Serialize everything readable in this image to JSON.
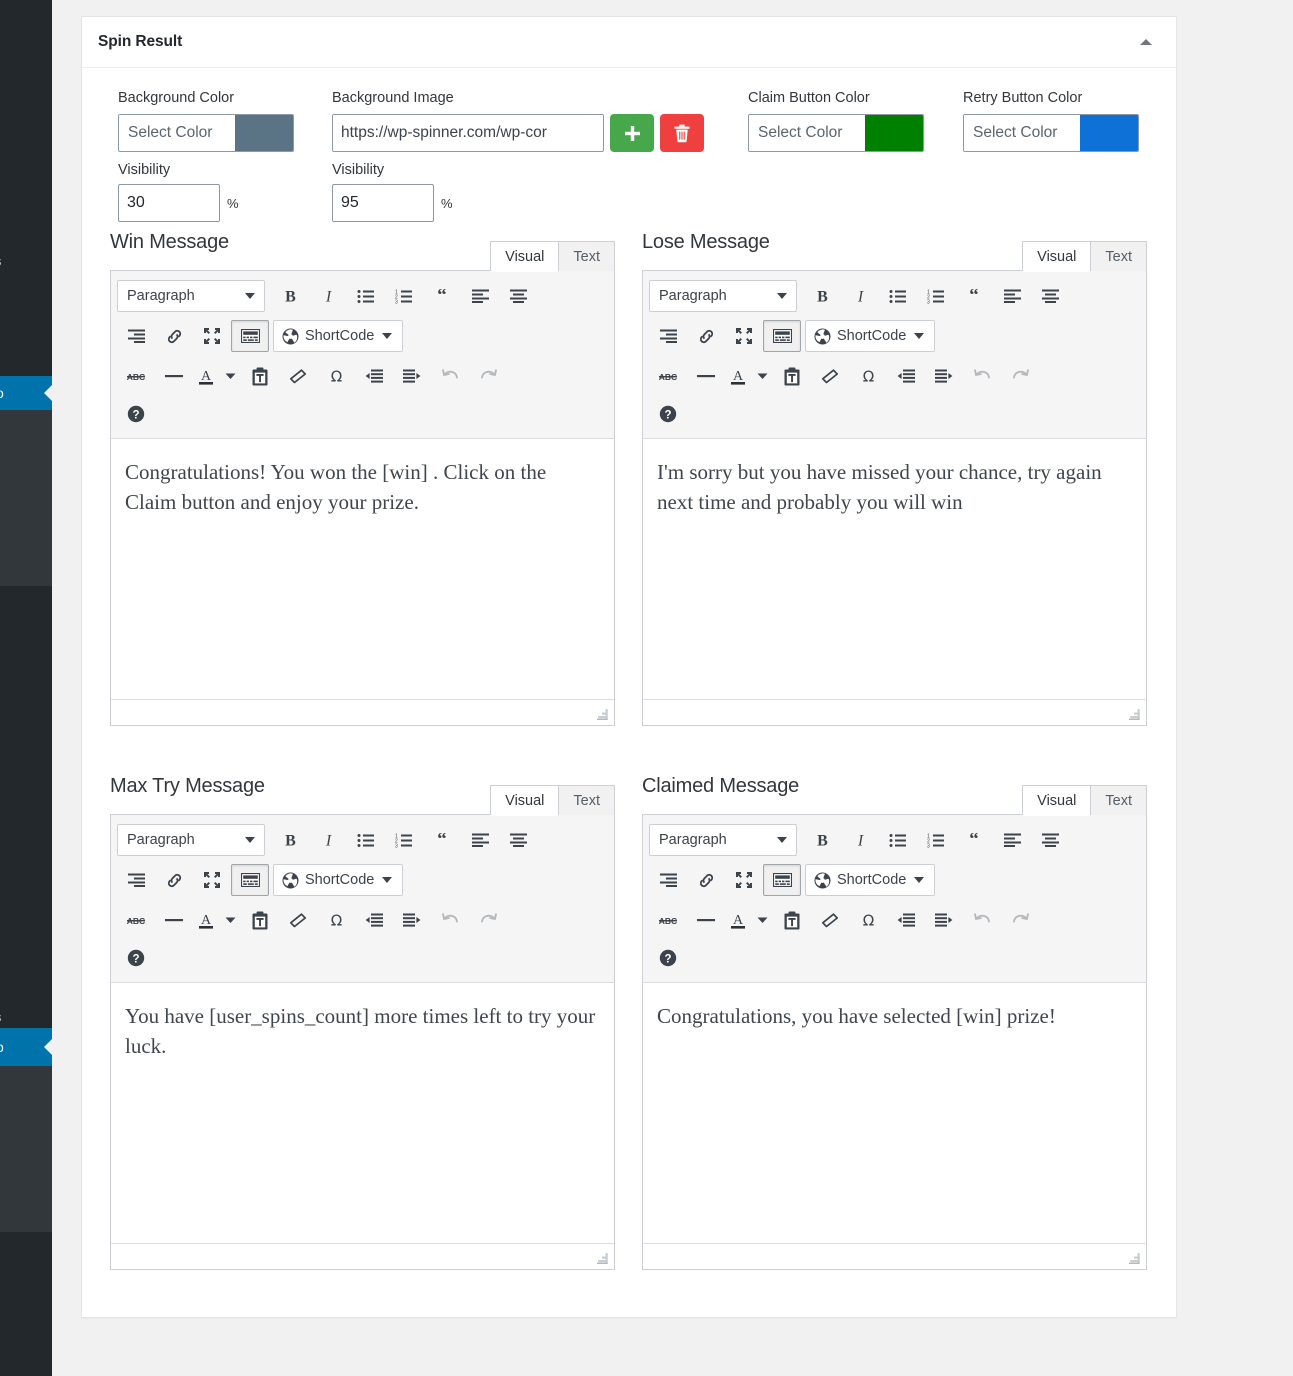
{
  "sidebar": {
    "items": [
      {
        "name": "menu-item-upper",
        "label": "",
        "state": "dark"
      },
      {
        "name": "menu-item-truncated-1",
        "label": "s",
        "state": "dark-letter"
      },
      {
        "name": "menu-item-active-1",
        "label": "o",
        "state": "active"
      },
      {
        "name": "menu-item-submenu-1",
        "label": "",
        "state": "mid"
      },
      {
        "name": "menu-item-middle",
        "label": "",
        "state": "dark"
      },
      {
        "name": "menu-item-truncated-2",
        "label": "s",
        "state": "dark-letter"
      },
      {
        "name": "menu-item-active-2",
        "label": "o",
        "state": "active"
      },
      {
        "name": "menu-item-submenu-2",
        "label": "",
        "state": "mid"
      },
      {
        "name": "menu-item-lower",
        "label": "",
        "state": "dark"
      }
    ]
  },
  "panel": {
    "title": "Spin Result",
    "toggle_icon": "caret-up-icon"
  },
  "controls": {
    "background_color": {
      "label": "Background Color",
      "placeholder": "Select Color",
      "swatch_hex": "#5a7385",
      "visibility_label": "Visibility",
      "visibility_value": "30",
      "unit": "%"
    },
    "background_image": {
      "label": "Background Image",
      "value": "https://wp-spinner.com/wp-cor",
      "add_icon": "plus-icon",
      "delete_icon": "trash-icon",
      "add_color": "#46a84b",
      "delete_color": "#ef3f3f",
      "visibility_label": "Visibility",
      "visibility_value": "95",
      "unit": "%"
    },
    "claim_button_color": {
      "label": "Claim Button Color",
      "placeholder": "Select Color",
      "swatch_hex": "#008000"
    },
    "retry_button_color": {
      "label": "Retry Button Color",
      "placeholder": "Select Color",
      "swatch_hex": "#0d71d8"
    }
  },
  "editor_common": {
    "tabs": {
      "visual": "Visual",
      "text": "Text",
      "active": "Visual"
    },
    "format_select": "Paragraph",
    "shortcode_label": "ShortCode",
    "toolbar_row1": [
      {
        "name": "bold-icon",
        "title": "B"
      },
      {
        "name": "italic-icon",
        "title": "I"
      },
      {
        "name": "bulleted-list-icon",
        "title": ""
      },
      {
        "name": "numbered-list-icon",
        "title": ""
      },
      {
        "name": "blockquote-icon",
        "title": ""
      },
      {
        "name": "align-left-icon",
        "title": ""
      },
      {
        "name": "align-center-icon",
        "title": ""
      }
    ],
    "toolbar_row2": [
      {
        "name": "align-right-icon",
        "title": ""
      },
      {
        "name": "insert-link-icon",
        "title": ""
      },
      {
        "name": "fullscreen-icon",
        "title": ""
      },
      {
        "name": "toolbar-toggle-icon",
        "title": ""
      }
    ],
    "toolbar_row3": [
      {
        "name": "strikethrough-icon",
        "title": "ABC"
      },
      {
        "name": "horizontal-rule-icon",
        "title": ""
      },
      {
        "name": "text-color-icon",
        "title": "A"
      },
      {
        "name": "text-color-caret-icon",
        "title": ""
      },
      {
        "name": "paste-as-text-icon",
        "title": ""
      },
      {
        "name": "clear-formatting-icon",
        "title": ""
      },
      {
        "name": "special-character-icon",
        "title": "Ω"
      },
      {
        "name": "outdent-icon",
        "title": ""
      },
      {
        "name": "indent-icon",
        "title": ""
      },
      {
        "name": "undo-icon",
        "title": ""
      },
      {
        "name": "redo-icon",
        "title": ""
      }
    ],
    "toolbar_row4": [
      {
        "name": "keyboard-shortcuts-icon",
        "title": "?"
      }
    ]
  },
  "editors": [
    {
      "key": "win_message",
      "title": "Win Message",
      "content": "Congratulations! You won the [win] . Click on the Claim button and enjoy your prize."
    },
    {
      "key": "lose_message",
      "title": "Lose Message",
      "content": "I'm sorry but you have missed your chance, try again next time and probably you will win"
    },
    {
      "key": "max_try_message",
      "title": "Max Try Message",
      "content": "You have [user_spins_count] more times left to try your luck."
    },
    {
      "key": "claimed_message",
      "title": "Claimed Message",
      "content": "Congratulations, you have selected [win] prize!"
    }
  ]
}
